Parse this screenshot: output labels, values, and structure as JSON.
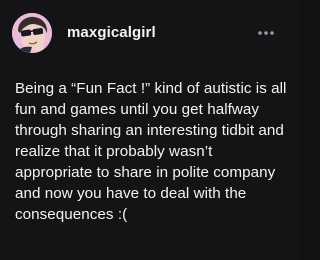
{
  "post": {
    "username": "maxgicalgirl",
    "avatar_icon": "sunglasses-face-icon",
    "menu_icon": "more-dots-icon",
    "body": "Being a “Fun Fact !” kind of autistic is all fun and games until you get halfway through sharing an interesting tidbit and realize that it probably wasn’t appropriate to share in polite company and now you have to deal with the consequences :("
  },
  "colors": {
    "background": "#141416",
    "text": "#f3f3f3",
    "avatar_bg": "#e7b8d8",
    "menu_dots": "#9a9aa0"
  }
}
